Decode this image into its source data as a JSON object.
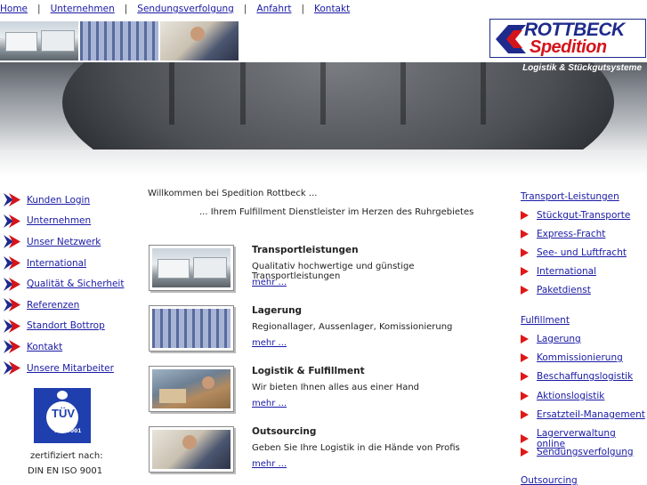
{
  "topnav": [
    {
      "label": "Home"
    },
    {
      "label": "Unternehmen"
    },
    {
      "label": "Sendungsverfolgung"
    },
    {
      "label": "Anfahrt"
    },
    {
      "label": "Kontakt"
    }
  ],
  "topnav_separator": "|",
  "logo": {
    "line1": "ROTTBECK",
    "line2": "Spedition",
    "tagline": "Logistik & Stückgutsysteme"
  },
  "leftnav": [
    {
      "label": "Kunden Login"
    },
    {
      "label": "Unternehmen"
    },
    {
      "label": "Unser Netzwerk"
    },
    {
      "label": "International"
    },
    {
      "label": "Qualität & Sicherheit"
    },
    {
      "label": "Referenzen"
    },
    {
      "label": "Standort Bottrop"
    },
    {
      "label": "Kontakt"
    },
    {
      "label": "Unsere Mitarbeiter"
    }
  ],
  "certification": {
    "badge_text": "TÜV",
    "badge_sub": "ISO 9001",
    "line1": "zertifiziert nach:",
    "line2": "DIN EN ISO 9001"
  },
  "main": {
    "welcome": "Willkommen bei Spedition Rottbeck ...",
    "subtitle": "... Ihrem Fulfillment Dienstleister im Herzen des Ruhrgebietes",
    "services": [
      {
        "title": "Transportleistungen",
        "desc": "Qualitativ hochwertige und günstige Transportleistungen",
        "more": "mehr ..."
      },
      {
        "title": "Lagerung",
        "desc": "Regionallager, Aussenlager, Komissionierung",
        "more": "mehr ..."
      },
      {
        "title": "Logistik & Fulfillment",
        "desc": "Wir bieten Ihnen alles aus einer Hand",
        "more": "mehr ..."
      },
      {
        "title": "Outsourcing",
        "desc": "Geben Sie Ihre Logistik in die Hände von Profis",
        "more": "mehr ..."
      }
    ]
  },
  "rightnav": {
    "transport": {
      "heading": "Transport-Leistungen",
      "items": [
        "Stückgut-Transporte",
        "Express-Fracht",
        "See- und Luftfracht",
        "International",
        "Paketdienst"
      ]
    },
    "fulfillment": {
      "heading": "Fulfillment",
      "items": [
        "Lagerung",
        "Kommissionierung",
        "Beschaffungslogistik",
        "Aktionslogistik",
        "Ersatzteil-Management",
        "Lagerverwaltung online",
        "Sendungsverfolgung"
      ]
    },
    "outsourcing": {
      "heading": "Outsourcing"
    }
  },
  "colors": {
    "link": "#1a1aa6",
    "brand_blue": "#1e2a8c",
    "brand_red": "#d4141b",
    "bullet_red": "#e01818"
  }
}
